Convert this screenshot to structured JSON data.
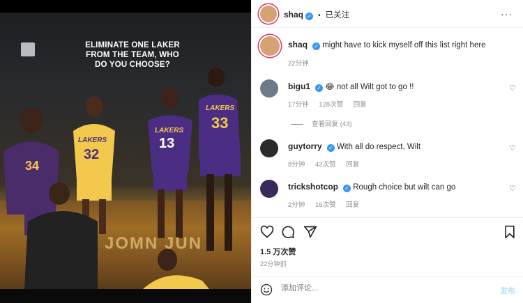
{
  "post": {
    "poster_headline": "ELIMINATE ONE LAKER FROM THE TEAM, WHO DO YOU CHOOSE?",
    "court_sign": "JOMN JUN",
    "jersey_numbers": [
      "34",
      "32",
      "13",
      "33"
    ],
    "jersey_text": [
      "LAKERS",
      "LAKERS",
      "LAKERS"
    ]
  },
  "header": {
    "username": "shaq",
    "separator": "•",
    "follow_label": "已关注",
    "more_label": "···"
  },
  "caption": {
    "username": "shaq",
    "text": "might have to kick myself off this list right here",
    "time": "22分钟"
  },
  "comments": [
    {
      "username": "bigu1",
      "emoji": "😂",
      "text": "not all Wilt got to go !!",
      "time": "17分钟",
      "likes": "128次赞",
      "reply": "回复"
    },
    {
      "username": "guytorry",
      "text": "With all do respect, Wilt",
      "time": "8分钟",
      "likes": "42次赞",
      "reply": "回复"
    },
    {
      "username": "trickshotcop",
      "text": "Rough choice but wilt can go",
      "time": "2分钟",
      "likes": "16次赞",
      "reply": "回复"
    }
  ],
  "view_replies": "查看回复 (43)",
  "likes_total": "1.5 万次赞",
  "posted_ago": "22分钟前",
  "composer": {
    "placeholder": "添加评论...",
    "post_label": "发布"
  },
  "colors": {
    "verified": "#3897f0",
    "story_ring": "#e1306c",
    "post_button": "#b2dffc"
  },
  "icons": [
    "heart-icon",
    "comment-icon",
    "share-icon",
    "bookmark-icon",
    "emoji-icon"
  ]
}
